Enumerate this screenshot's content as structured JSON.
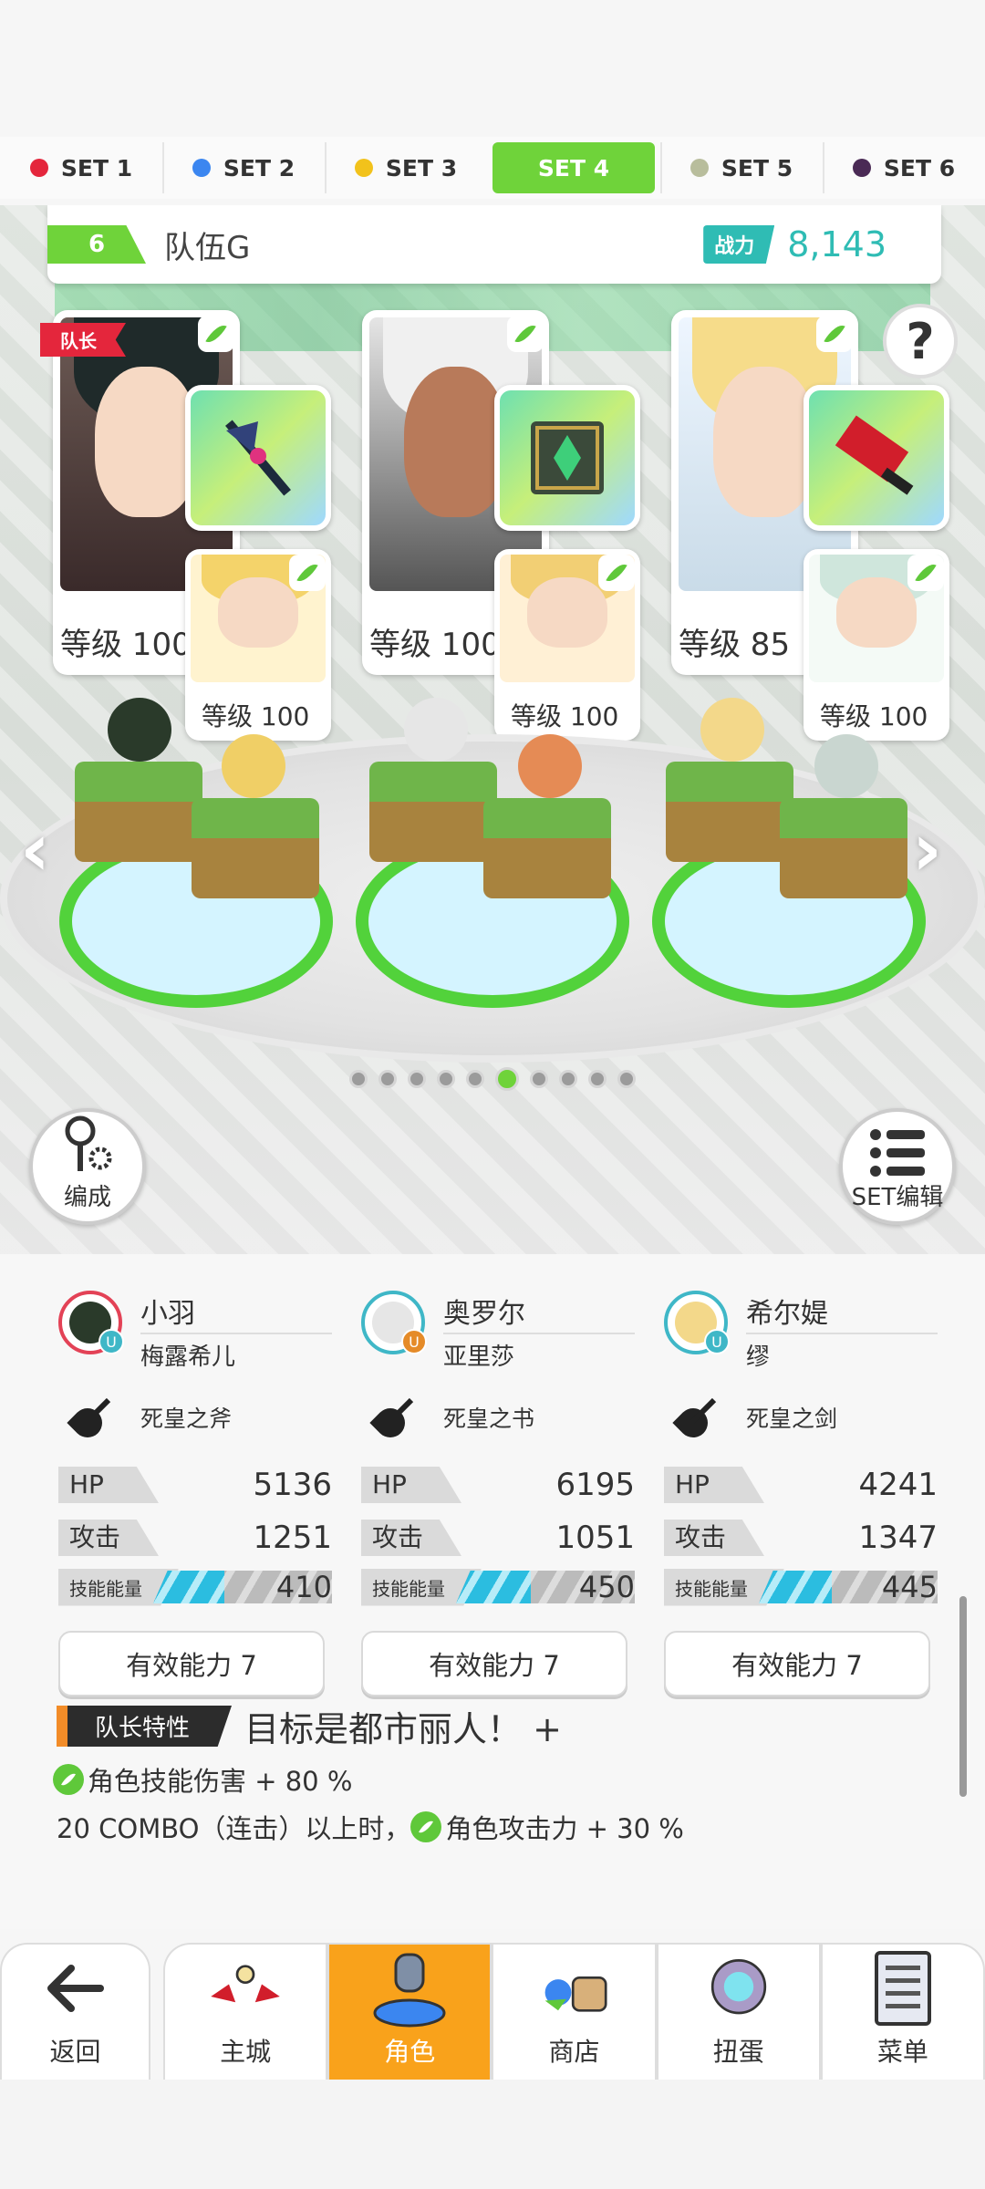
{
  "set_tabs": [
    {
      "label": "SET 1",
      "color": "#e4263c",
      "active": false
    },
    {
      "label": "SET 2",
      "color": "#3b86f0",
      "active": false
    },
    {
      "label": "SET 3",
      "color": "#f2c21b",
      "active": false
    },
    {
      "label": "SET 4",
      "color": "#6fd33a",
      "active": true
    },
    {
      "label": "SET 5",
      "color": "#b8bd9c",
      "active": false
    },
    {
      "label": "SET 6",
      "color": "#4a2a55",
      "active": false
    }
  ],
  "team": {
    "number": "6",
    "name": "队伍G",
    "power_label": "战力",
    "power": "8,143"
  },
  "help_icon": "?",
  "leader_ribbon": "队长",
  "cards": [
    {
      "main_level": "等级 100",
      "sub_level": "等级 100"
    },
    {
      "main_level": "等级 100",
      "sub_level": "等级 100"
    },
    {
      "main_level": "等级 85",
      "sub_level": "等级 100"
    }
  ],
  "pager": {
    "count": 10,
    "active_index": 5
  },
  "left_button": {
    "label": "编成",
    "icon": "key-gear-icon"
  },
  "right_button": {
    "label": "SET编辑",
    "icon": "list-icon"
  },
  "characters": [
    {
      "name": "小羽",
      "sub": "梅露希儿",
      "weapon": "死皇之斧",
      "hp_label": "HP",
      "hp": "5136",
      "atk_label": "攻击",
      "atk": "1251",
      "energy_label": "技能能量",
      "energy": "410",
      "energy_pct": 0.4,
      "ability": "有效能力 7"
    },
    {
      "name": "奥罗尔",
      "sub": "亚里莎",
      "weapon": "死皇之书",
      "hp_label": "HP",
      "hp": "6195",
      "atk_label": "攻击",
      "atk": "1051",
      "energy_label": "技能能量",
      "energy": "450",
      "energy_pct": 0.42,
      "ability": "有效能力 7"
    },
    {
      "name": "希尔媞",
      "sub": "缪",
      "weapon": "死皇之剑",
      "hp_label": "HP",
      "hp": "4241",
      "atk_label": "攻击",
      "atk": "1347",
      "energy_label": "技能能量",
      "energy": "445",
      "energy_pct": 0.41,
      "ability": "有效能力 7"
    }
  ],
  "leader_skill": {
    "label": "队长特性",
    "title": "目标是都市丽人！ +",
    "line1": "角色技能伤害 + 80 %",
    "line2_prefix": "20 COMBO（连击）以上时，",
    "line2_suffix": "角色攻击力 + 30 %"
  },
  "nav": {
    "back": "返回",
    "items": [
      {
        "label": "主城",
        "icon": "castle-icon"
      },
      {
        "label": "角色",
        "icon": "character-icon"
      },
      {
        "label": "商店",
        "icon": "shop-icon"
      },
      {
        "label": "扭蛋",
        "icon": "gacha-icon"
      },
      {
        "label": "菜单",
        "icon": "menu-icon"
      }
    ]
  }
}
